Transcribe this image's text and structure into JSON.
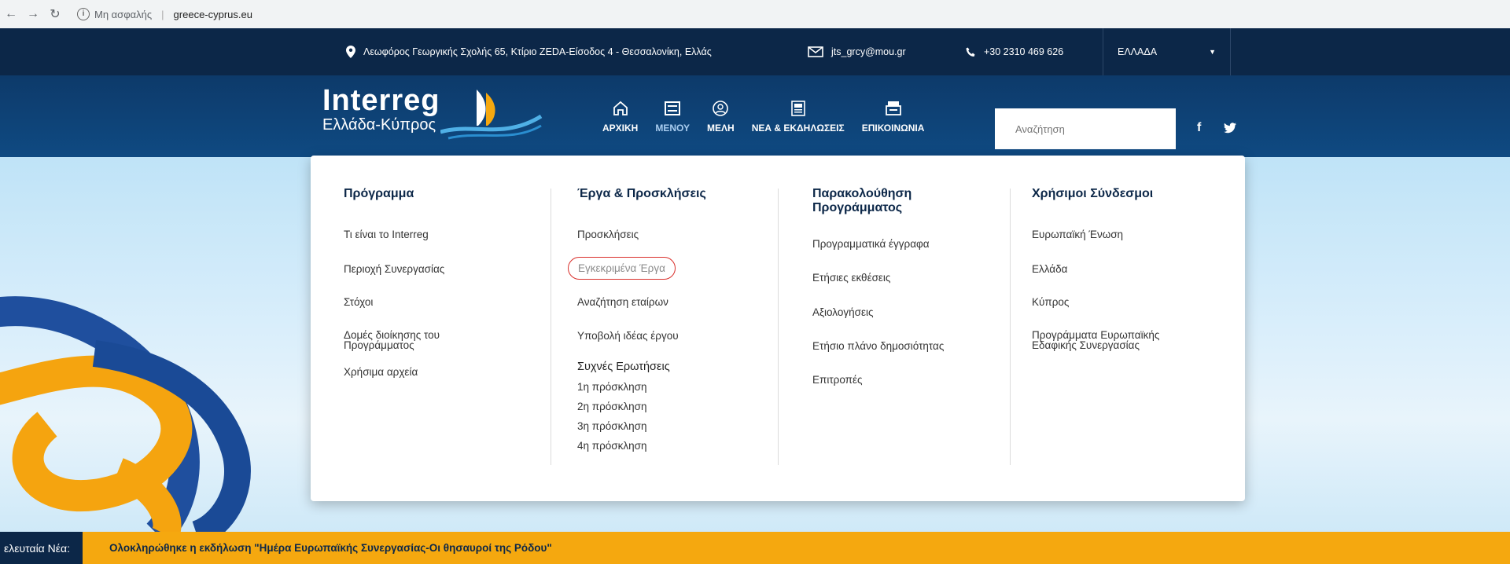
{
  "browser": {
    "security_label": "Μη ασφαλής",
    "url": "greece-cyprus.eu",
    "info_glyph": "i"
  },
  "topbar": {
    "address": "Λεωφόρος Γεωργικής Σχολής 65, Κτίριο ΖΕDA-Είσοδος 4 - Θεσσαλονίκη, Ελλάς",
    "email": "jts_grcy@mou.gr",
    "phone": "+30 2310 469 626",
    "language": "ΕΛΛΑΔΑ"
  },
  "header": {
    "logo_brand": "Interreg",
    "logo_sub": "Ελλάδα-Κύπρος",
    "nav": [
      {
        "label": "ΑΡΧΙΚΗ",
        "icon": "home-icon"
      },
      {
        "label": "ΜΕΝΟΥ",
        "icon": "menu-icon"
      },
      {
        "label": "ΜΕΛΗ",
        "icon": "members-icon"
      },
      {
        "label": "ΝΕΑ & ΕΚΔΗΛΩΣΕΙΣ",
        "icon": "news-icon"
      },
      {
        "label": "ΕΠΙΚΟΙΝΩΝΙΑ",
        "icon": "contact-icon"
      }
    ],
    "search_placeholder": "Αναζήτηση",
    "social": {
      "facebook": "f",
      "twitter": "t"
    }
  },
  "megamenu": {
    "columns": [
      {
        "title": "Πρόγραμμα",
        "links": [
          "Τι είναι το Interreg",
          "Περιοχή Συνεργασίας",
          "Στόχοι",
          "Δομές διοίκησης του Προγράμματος",
          "Χρήσιμα αρχεία"
        ]
      },
      {
        "title": "Έργα & Προσκλήσεις",
        "links": [
          "Προσκλήσεις",
          "Εγκεκριμένα Έργα",
          "Αναζήτηση εταίρων",
          "Υποβολή ιδέας έργου"
        ],
        "faq_title": "Συχνές Ερωτήσεις",
        "faq_links": [
          "1η πρόσκληση",
          "2η πρόσκληση",
          "3η πρόσκληση",
          "4η πρόσκληση"
        ]
      },
      {
        "title": "Παρακολούθηση Προγράμματος",
        "links": [
          "Προγραμματικά έγγραφα",
          "Ετήσιες εκθέσεις",
          "Αξιολογήσεις",
          "Ετήσιο πλάνο δημοσιότητας",
          "Επιτροπές"
        ]
      },
      {
        "title": "Χρήσιμοι Σύνδεσμοι",
        "links": [
          "Ευρωπαϊκή Ένωση",
          "Ελλάδα",
          "Κύπρος",
          "Προγράμματα Ευρωπαϊκής Εδαφικής Συνεργασίας"
        ]
      }
    ],
    "highlighted_link": "Εγκεκριμένα Έργα"
  },
  "ticker": {
    "label": "ελευταία Νέα:",
    "text": "Ολοκληρώθηκε η εκδήλωση \"Ημέρα Ευρωπαϊκής Συνεργασίας-Οι θησαυροί της Ρόδου\""
  },
  "colors": {
    "navy": "#0c2748",
    "header_blue": "#0f4a82",
    "ticker_orange": "#f5a80f",
    "highlight_red": "#d9302c"
  }
}
